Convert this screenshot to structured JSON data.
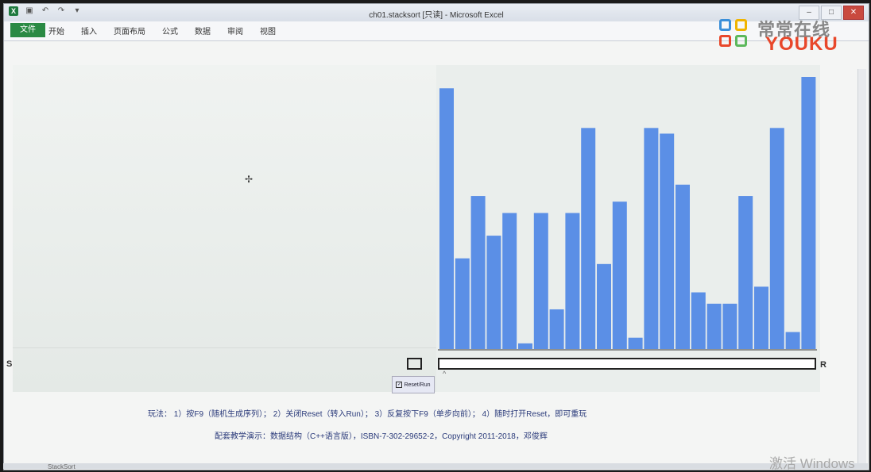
{
  "titlebar": {
    "title": "ch01.stacksort [只读] - Microsoft Excel"
  },
  "ribbon": {
    "tabs": [
      "文件",
      "开始",
      "插入",
      "页面布局",
      "公式",
      "数据",
      "审阅",
      "视图"
    ]
  },
  "logo": {
    "line1": "常常在线",
    "line2": "YOUKU",
    "colors": [
      "#3b8fd9",
      "#e8472a",
      "#f0b400",
      "#5cb85c"
    ]
  },
  "sheet": {
    "label_s": "S",
    "label_r": "R",
    "reset_button": "Reset/Run",
    "reset_checked": true,
    "caret": "^",
    "instructions": "玩法： 1）按F9（随机生成序列）； 2）关闭Reset（转入Run）； 3）反复按下F9（单步向前）； 4）随时打开Reset，即可重玩",
    "reference": "配套教学演示：数据结构（C++语言版），ISBN-7-302-29652-2，Copyright 2011-2018，邓俊辉"
  },
  "sheet_tab": "StackSort",
  "watermark": "激活 Windows",
  "chart_data": {
    "type": "bar",
    "color": "#5b8fe6",
    "values": [
      46,
      16,
      27,
      20,
      24,
      1,
      24,
      7,
      24,
      39,
      15,
      26,
      2,
      39,
      38,
      29,
      10,
      8,
      8,
      27,
      11,
      39,
      3,
      48
    ],
    "ylim": [
      0,
      48
    ]
  }
}
